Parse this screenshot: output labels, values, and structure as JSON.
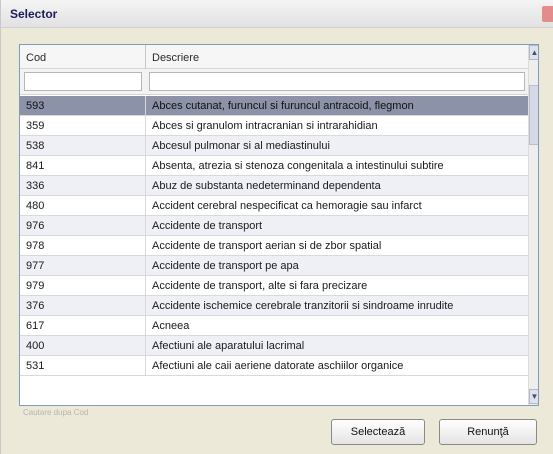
{
  "window": {
    "title": "Selector"
  },
  "grid": {
    "columns": [
      "Cod",
      "Descriere"
    ],
    "rows": [
      {
        "code": "593",
        "desc": "Abces cutanat, furuncul si furuncul antracoid, flegmon"
      },
      {
        "code": "359",
        "desc": "Abces si granulom intracranian si intrarahidian"
      },
      {
        "code": "538",
        "desc": "Abcesul pulmonar si al mediastinului"
      },
      {
        "code": "841",
        "desc": "Absenta, atrezia si stenoza congenitala a intestinului subtire"
      },
      {
        "code": "336",
        "desc": "Abuz de substanta nedeterminand dependenta"
      },
      {
        "code": "480",
        "desc": "Accident cerebral nespecificat ca hemoragie sau infarct"
      },
      {
        "code": "976",
        "desc": "Accidente de transport"
      },
      {
        "code": "978",
        "desc": "Accidente de transport aerian si de zbor spatial"
      },
      {
        "code": "977",
        "desc": "Accidente de transport pe apa"
      },
      {
        "code": "979",
        "desc": "Accidente de transport, alte si fara precizare"
      },
      {
        "code": "376",
        "desc": "Accidente ischemice cerebrale tranzitorii si sindroame inrudite"
      },
      {
        "code": "617",
        "desc": "Acneea"
      },
      {
        "code": "400",
        "desc": "Afectiuni ale aparatului lacrimal"
      },
      {
        "code": "531",
        "desc": "Afectiuni ale caii aeriene datorate aschiilor organice"
      }
    ]
  },
  "status_text": "Cautare dupa Cod",
  "buttons": {
    "select": "Selectează",
    "cancel": "Renunţă"
  }
}
